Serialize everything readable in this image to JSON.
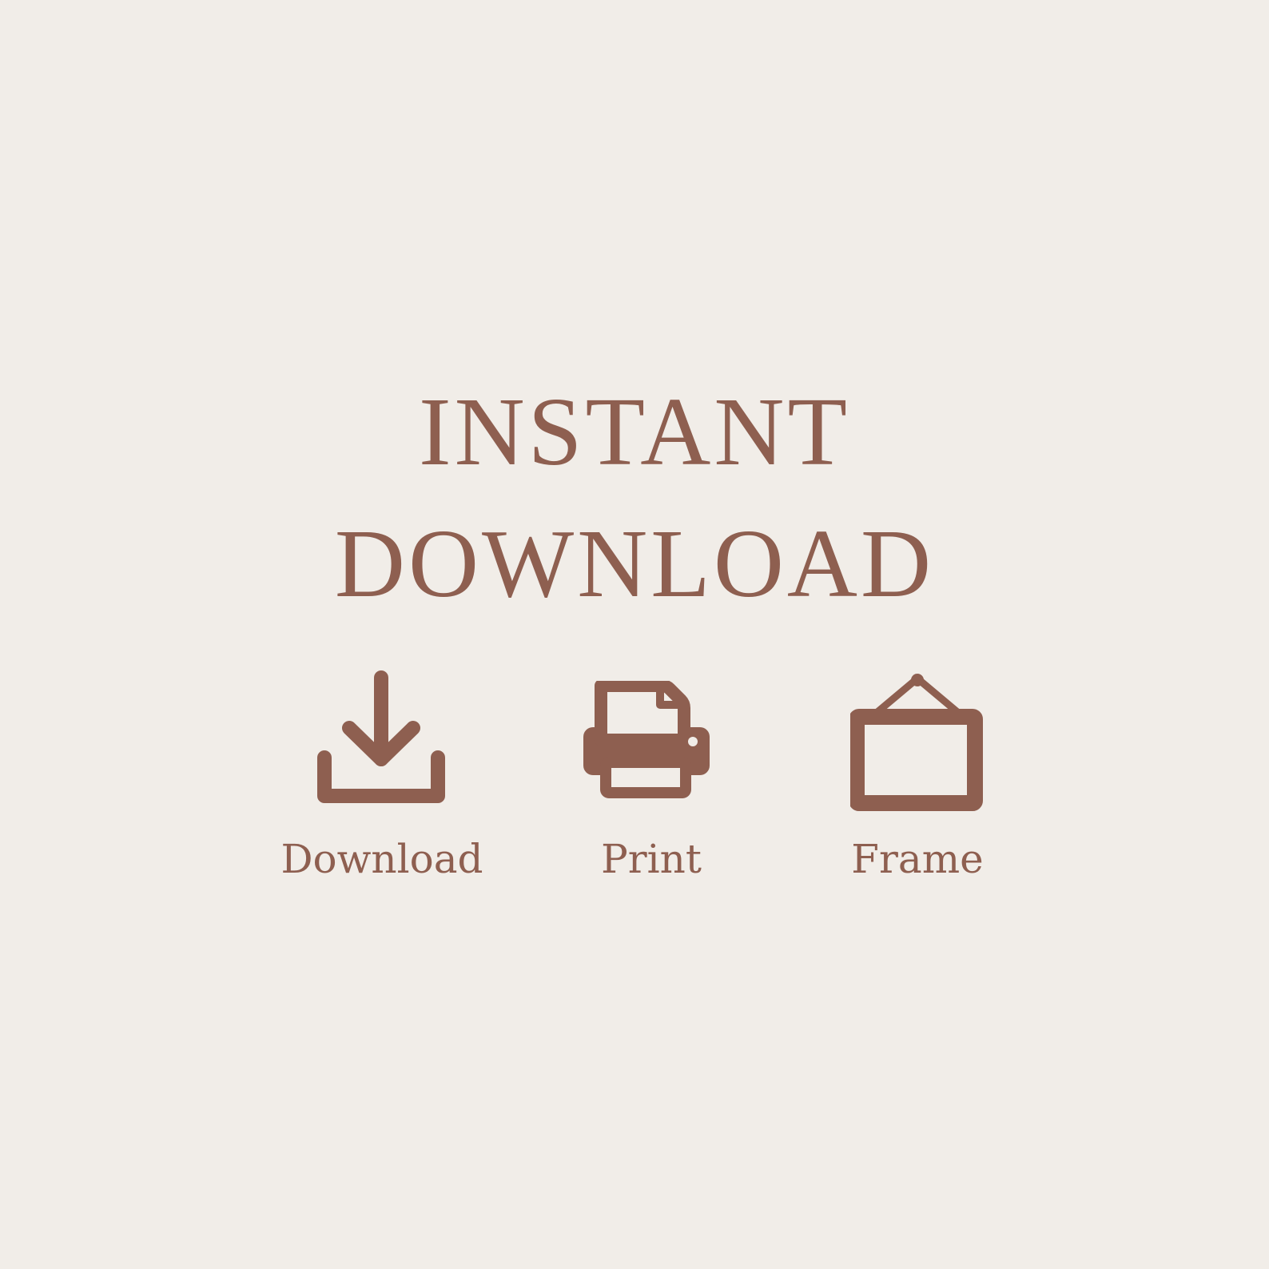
{
  "title": {
    "line1": "INSTANT",
    "line2": "DOWNLOAD"
  },
  "colors": {
    "background": "#f1ede8",
    "accent": "#8e5f50"
  },
  "features": [
    {
      "icon": "download-icon",
      "label": "Download"
    },
    {
      "icon": "printer-icon",
      "label": "Print"
    },
    {
      "icon": "hanging-frame-icon",
      "label": "Frame"
    }
  ]
}
